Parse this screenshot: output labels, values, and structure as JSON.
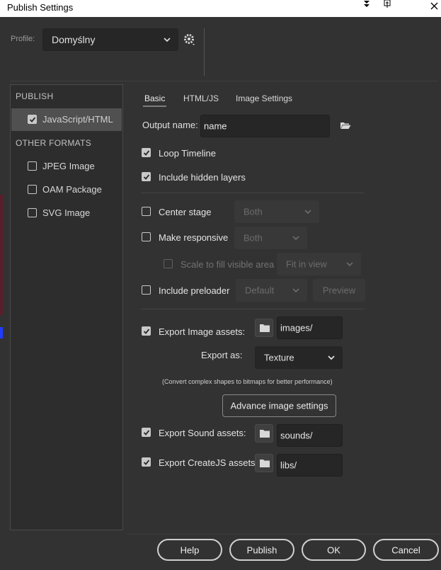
{
  "window": {
    "title": "Publish Settings"
  },
  "profile": {
    "label": "Profile:",
    "value": "Domyślny"
  },
  "sidebar": {
    "publish_header": "PUBLISH",
    "publish_items": [
      {
        "label": "JavaScript/HTML",
        "checked": true
      }
    ],
    "other_header": "OTHER FORMATS",
    "other_items": [
      {
        "label": "JPEG Image",
        "checked": false
      },
      {
        "label": "OAM Package",
        "checked": false
      },
      {
        "label": "SVG Image",
        "checked": false
      }
    ]
  },
  "tabs": {
    "basic": "Basic",
    "html_js": "HTML/JS",
    "image_settings": "Image Settings"
  },
  "basic": {
    "output_name_label": "Output name:",
    "output_name_value": "name",
    "loop_timeline": {
      "label": "Loop Timeline",
      "checked": true
    },
    "include_hidden_layers": {
      "label": "Include hidden layers",
      "checked": true
    },
    "center_stage": {
      "label": "Center stage",
      "checked": false,
      "select": "Both"
    },
    "make_responsive": {
      "label": "Make responsive",
      "checked": false,
      "select": "Both"
    },
    "scale_to_fill": {
      "label": "Scale to fill visible area",
      "checked": false,
      "select": "Fit in view"
    },
    "include_preloader": {
      "label": "Include preloader",
      "checked": false,
      "select": "Default",
      "preview_label": "Preview"
    },
    "export_image_assets": {
      "label": "Export Image assets:",
      "checked": true,
      "path": "images/"
    },
    "export_as": {
      "label": "Export as:",
      "value": "Texture"
    },
    "convert_note": "(Convert complex shapes to bitmaps for better performance)",
    "advance_image_settings": "Advance image settings",
    "export_sound_assets": {
      "label": "Export Sound assets:",
      "checked": true,
      "path": "sounds/"
    },
    "export_createjs_assets": {
      "label": "Export CreateJS assets:",
      "checked": true,
      "path": "libs/"
    }
  },
  "footer": {
    "help": "Help",
    "publish": "Publish",
    "ok": "OK",
    "cancel": "Cancel"
  },
  "colors": {
    "background": "#323232",
    "titlebar": "#ffffff",
    "sidebar_selected": "#505050"
  }
}
